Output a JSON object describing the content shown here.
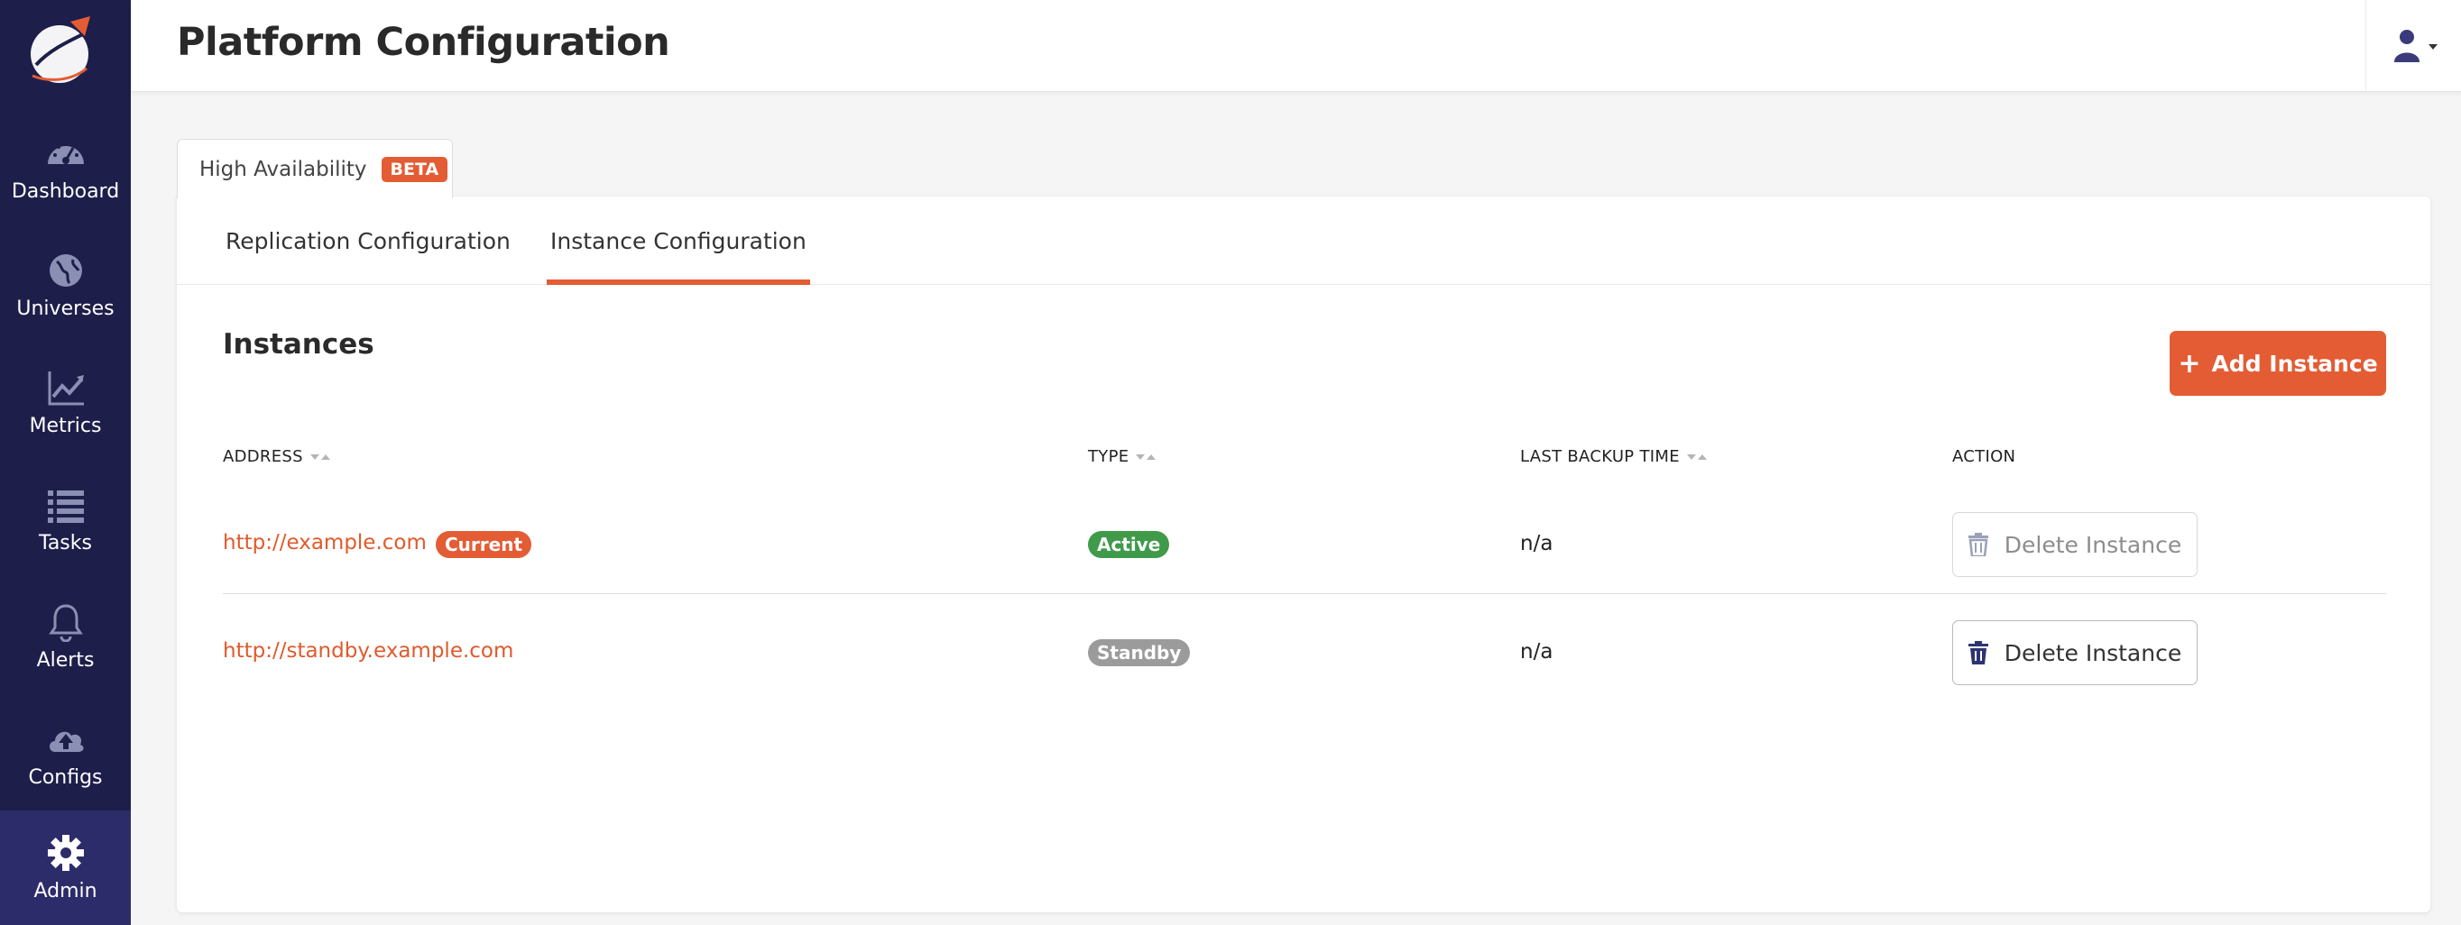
{
  "header": {
    "title": "Platform Configuration"
  },
  "sidebar": {
    "items": [
      {
        "label": "Dashboard",
        "icon": "dashboard-icon"
      },
      {
        "label": "Universes",
        "icon": "globe-icon"
      },
      {
        "label": "Metrics",
        "icon": "chart-line-icon"
      },
      {
        "label": "Tasks",
        "icon": "list-icon"
      },
      {
        "label": "Alerts",
        "icon": "bell-icon"
      },
      {
        "label": "Configs",
        "icon": "cloud-upload-icon"
      },
      {
        "label": "Admin",
        "icon": "gear-icon",
        "active": true
      }
    ]
  },
  "outer_tab": {
    "label": "High Availability",
    "badge": "BETA"
  },
  "subtabs": [
    {
      "label": "Replication Configuration",
      "active": false
    },
    {
      "label": "Instance Configuration",
      "active": true
    }
  ],
  "instances": {
    "title": "Instances",
    "add_button": "Add Instance",
    "columns": [
      "ADDRESS",
      "TYPE",
      "LAST BACKUP TIME",
      "ACTION"
    ],
    "rows": [
      {
        "address": "http://example.com",
        "current_badge": "Current",
        "type": "Active",
        "last_backup": "n/a",
        "action": "Delete Instance"
      },
      {
        "address": "http://standby.example.com",
        "type": "Standby",
        "last_backup": "n/a",
        "action": "Delete Instance"
      }
    ]
  },
  "colors": {
    "brand": "#e35c34",
    "sidebar_bg": "#1e1e4b",
    "active_badge": "#3f9a4a",
    "standby_badge": "#9b9b9b",
    "link": "#e05a2b"
  }
}
